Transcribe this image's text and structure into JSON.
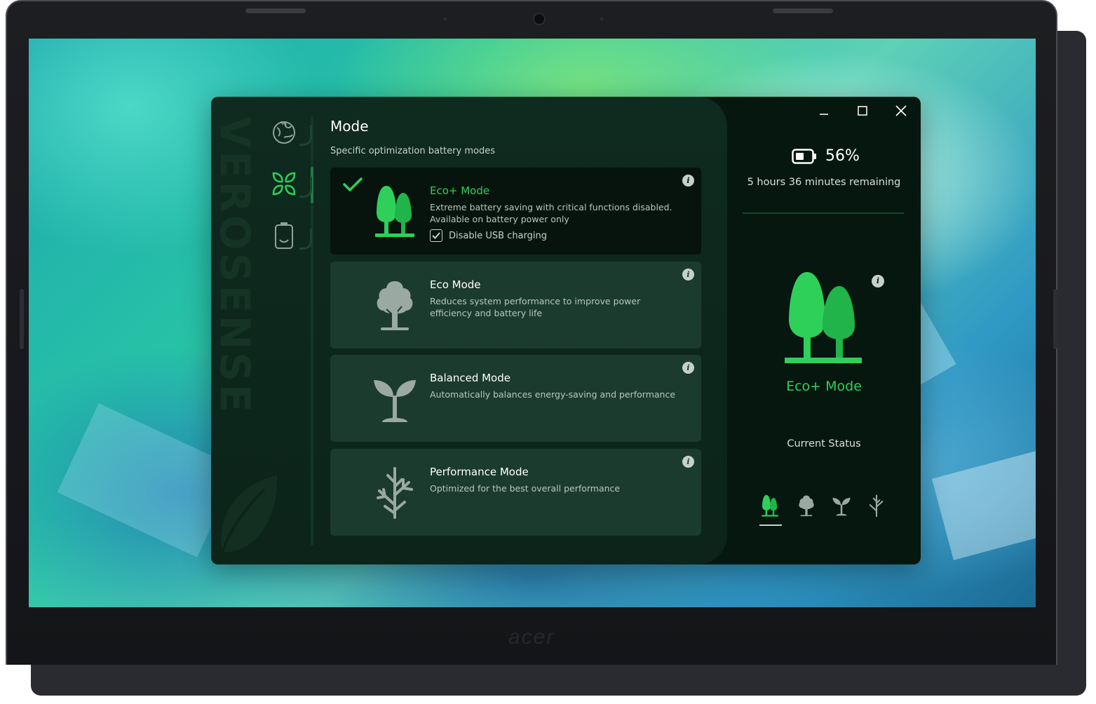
{
  "app": {
    "brand_vertical": "VEROSENSE",
    "page_title": "Mode",
    "page_subtitle": "Specific optimization battery modes",
    "nav": [
      "earth-icon",
      "leaves-icon",
      "battery-icon"
    ]
  },
  "modes": [
    {
      "name": "Eco+ Mode",
      "description": "Extreme battery saving with critical functions disabled. Available on battery power only",
      "selected": true,
      "option_label": "Disable USB charging",
      "option_checked": true
    },
    {
      "name": "Eco Mode",
      "description": "Reduces system performance to improve power efficiency and battery life",
      "selected": false
    },
    {
      "name": "Balanced Mode",
      "description": "Automatically balances energy-saving and performance",
      "selected": false
    },
    {
      "name": "Performance Mode",
      "description": "Optimized for the best overall performance",
      "selected": false
    }
  ],
  "status": {
    "battery_percent": "56%",
    "remaining": "5 hours 36 minutes remaining",
    "current_mode": "Eco+ Mode",
    "current_status_label": "Current Status"
  },
  "window_controls": {
    "minimize": "minimize-icon",
    "maximize": "maximize-icon",
    "close": "close-icon"
  },
  "device": {
    "logo": "acer"
  },
  "colors": {
    "accent_green": "#2ed05a",
    "panel_dark": "#06170f",
    "card": "#1c3b2f",
    "card_active": "#06140d"
  }
}
